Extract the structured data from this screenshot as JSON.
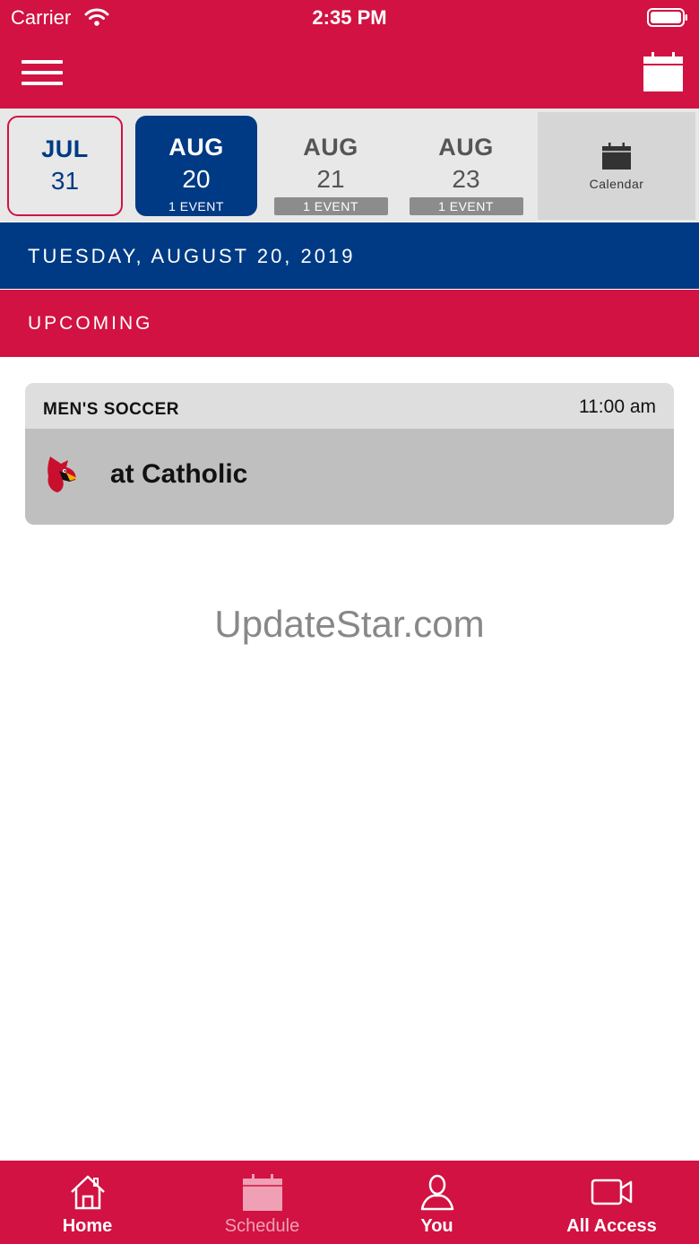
{
  "status_bar": {
    "carrier": "Carrier",
    "time": "2:35 PM"
  },
  "nav": {
    "menu_icon": "hamburger-icon",
    "calendar_icon": "calendar-icon"
  },
  "date_strip": {
    "cells": [
      {
        "month": "JUL",
        "day": "31",
        "events": "",
        "state": "outlined"
      },
      {
        "month": "AUG",
        "day": "20",
        "events": "1 EVENT",
        "state": "selected"
      },
      {
        "month": "AUG",
        "day": "21",
        "events": "1 EVENT",
        "state": "default"
      },
      {
        "month": "AUG",
        "day": "23",
        "events": "1 EVENT",
        "state": "default"
      }
    ],
    "calendar_label": "Calendar"
  },
  "date_header": "TUESDAY, AUGUST 20, 2019",
  "section_header": "UPCOMING",
  "event": {
    "sport": "MEN'S SOCCER",
    "time": "11:00 am",
    "title": "at Catholic",
    "logo_icon": "cardinal-logo-icon"
  },
  "watermark": "UpdateStar.com",
  "tabs": [
    {
      "label": "Home",
      "icon": "home-icon"
    },
    {
      "label": "Schedule",
      "icon": "calendar-icon",
      "state": "active"
    },
    {
      "label": "You",
      "icon": "user-icon"
    },
    {
      "label": "All Access",
      "icon": "video-camera-icon"
    }
  ],
  "colors": {
    "brand_red": "#d11242",
    "brand_blue": "#003a84",
    "card_gray": "#bfbfbf"
  }
}
